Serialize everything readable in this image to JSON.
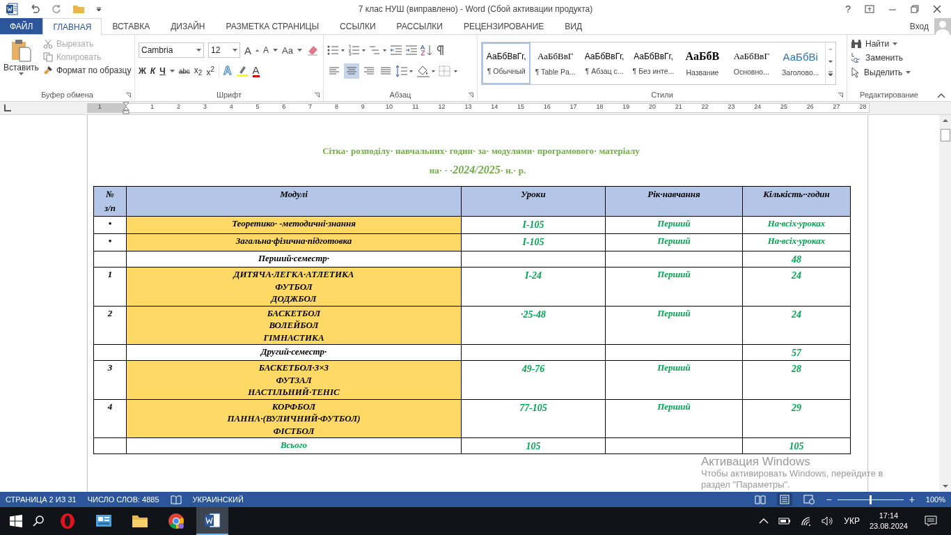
{
  "window": {
    "title": "7 клас НУШ (виправлено) - Word (Сбой активации продукта)",
    "help": "?"
  },
  "tabs": [
    {
      "label": "ФАЙЛ",
      "kind": "file",
      "selected": false
    },
    {
      "label": "ГЛАВНАЯ",
      "kind": "tab",
      "selected": true
    },
    {
      "label": "ВСТАВКА",
      "kind": "tab",
      "selected": false
    },
    {
      "label": "ДИЗАЙН",
      "kind": "tab",
      "selected": false
    },
    {
      "label": "РАЗМЕТКА СТРАНИЦЫ",
      "kind": "tab",
      "selected": false
    },
    {
      "label": "ССЫЛКИ",
      "kind": "tab",
      "selected": false
    },
    {
      "label": "РАССЫЛКИ",
      "kind": "tab",
      "selected": false
    },
    {
      "label": "РЕЦЕНЗИРОВАНИЕ",
      "kind": "tab",
      "selected": false
    },
    {
      "label": "ВИД",
      "kind": "tab",
      "selected": false
    }
  ],
  "account": "Вход",
  "clipboard": {
    "label": "Буфер обмена",
    "paste": "Вставить",
    "items": [
      {
        "label": "Вырезать",
        "disabled": true
      },
      {
        "label": "Копировать",
        "disabled": true
      },
      {
        "label": "Формат по образцу",
        "disabled": false
      }
    ]
  },
  "font": {
    "label": "Шрифт",
    "name": "Cambria",
    "size": "12",
    "grow": "A",
    "shrink": "A",
    "case": "Aa",
    "format": [
      "Ж",
      "К",
      "Ч",
      "abc",
      "x$_{2}$",
      "x$^{2}$"
    ],
    "effects": "A",
    "font_color_label": "A"
  },
  "paragraph": {
    "label": "Абзац"
  },
  "styles": {
    "label": "Стили",
    "items": [
      {
        "preview": "АаБбВвГг,",
        "name": "¶ Обычный",
        "kind": "normal",
        "selected": true
      },
      {
        "preview": "АаБбВвГ",
        "name": "¶ Table Pa...",
        "kind": "serif",
        "selected": false
      },
      {
        "preview": "АаБбВвГг,",
        "name": "¶ Абзац с...",
        "kind": "normal",
        "selected": false
      },
      {
        "preview": "АаБбВвГг,",
        "name": "¶ Без инте...",
        "kind": "normal",
        "selected": false
      },
      {
        "preview": "АаБбВ",
        "name": "Название",
        "kind": "title",
        "selected": false
      },
      {
        "preview": "АаБбВвГ",
        "name": "Основно...",
        "kind": "serif",
        "selected": false
      },
      {
        "preview": "АаБбВі",
        "name": "Заголово...",
        "kind": "heading",
        "selected": false
      }
    ]
  },
  "editing": {
    "label": "Редактирование",
    "items": [
      "Найти",
      "Заменить",
      "Выделить"
    ]
  },
  "ruler": [
    "1",
    "1",
    "2",
    "3",
    "4",
    "5",
    "6",
    "7",
    "8",
    "9",
    "10",
    "11",
    "12",
    "13",
    "14",
    "15",
    "16",
    "17",
    "18",
    "19",
    "20",
    "21",
    "22",
    "23",
    "24",
    "25",
    "26",
    "27",
    "28"
  ],
  "document": {
    "heading": "Сітка· розподілу· навчальних· годин· за· модулями· програмового· матеріалу",
    "subheading_prefix": "на· · ·",
    "year": "2024/2025",
    "subheading_suffix": "· н.· р.",
    "columns": [
      [
        "№",
        "з/п"
      ],
      [
        "Модулі"
      ],
      [
        "Уроки"
      ],
      [
        "Рік·навчання"
      ],
      [
        "Кількість··годин"
      ]
    ],
    "rows": [
      {
        "kind": "bullet",
        "number": "•",
        "modules": [
          "Теоретико· -методичні·знання"
        ],
        "lessons": "I-105",
        "year": "Перший",
        "hours": "На·всіх·уроках"
      },
      {
        "kind": "bullet",
        "number": "•",
        "modules": [
          "Загальна·фізична·підготовка"
        ],
        "lessons": "I-105",
        "year": "Перший",
        "hours": "На·всіх·уроках"
      },
      {
        "kind": "section",
        "modules": [
          "Перший·семестр·"
        ],
        "hours": "48"
      },
      {
        "kind": "module",
        "number": "1",
        "modules": [
          "ДИТЯЧА·ЛЕГКА·АТЛЕТИКА",
          "ФУТБОЛ",
          "ДОДЖБОЛ"
        ],
        "lessons": "I-24",
        "year": "Перший",
        "hours": "24"
      },
      {
        "kind": "module",
        "number": "2",
        "modules": [
          "БАСКЕТБОЛ",
          "ВОЛЕЙБОЛ",
          "ГІМНАСТИКА"
        ],
        "lessons": "·25-48",
        "year": "Перший",
        "hours": "24"
      },
      {
        "kind": "section",
        "modules": [
          "Другий·семестр·"
        ],
        "hours": "57"
      },
      {
        "kind": "module",
        "number": "3",
        "modules": [
          "БАСКЕТБОЛ·3×3",
          "ФУТЗАЛ",
          "НАСТІЛЬНИЙ·ТЕНІС"
        ],
        "lessons": "49-76",
        "year": "Перший",
        "hours": "28"
      },
      {
        "kind": "module",
        "number": "4",
        "modules": [
          "КОРФБОЛ",
          "ПАННА·(ВУЛИЧНИЙ·ФУТБОЛ)",
          "ФІСТБОЛ"
        ],
        "lessons": "77-105",
        "year": "Перший",
        "hours": "29"
      },
      {
        "kind": "total",
        "modules": [
          "Всього"
        ],
        "lessons": "105",
        "hours": "105"
      }
    ]
  },
  "activation": {
    "title": "Активация Windows",
    "text": [
      "Чтобы активировать Windows, перейдите в",
      "раздел \"Параметры\"."
    ]
  },
  "status_bar": {
    "page": "СТРАНИЦА 2 ИЗ 31",
    "words": "ЧИСЛО СЛОВ: 4885",
    "language": "УКРАИНСКИЙ",
    "zoom_out": "−",
    "zoom_in": "+",
    "zoom": "100%",
    "level": 0.5
  },
  "taskbar": {
    "apps": [
      {
        "kind": "opera",
        "selected": false
      },
      {
        "kind": "control",
        "selected": false
      },
      {
        "kind": "folder",
        "selected": false
      },
      {
        "kind": "chrome",
        "selected": false
      },
      {
        "kind": "word",
        "selected": true
      }
    ],
    "language": "УКР",
    "time": "17:14",
    "date": "23.08.2024"
  }
}
